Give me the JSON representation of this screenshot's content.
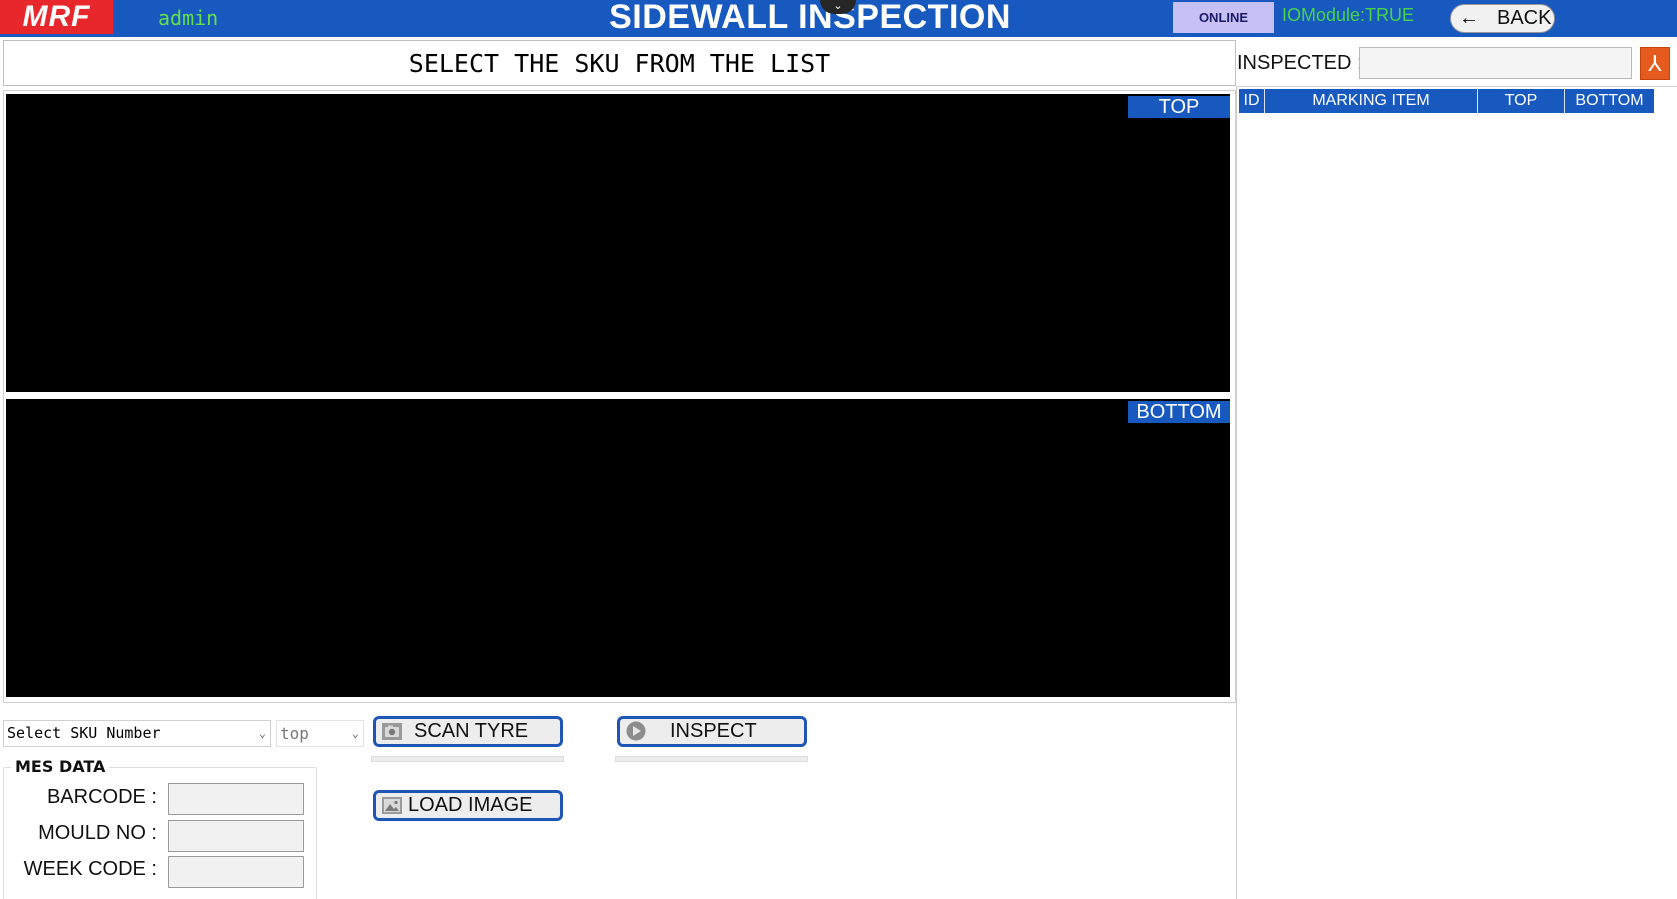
{
  "header": {
    "logo_text": "MRF",
    "user": "admin",
    "title": "SIDEWALL INSPECTION",
    "collapse_glyph": "⌄",
    "status": "ONLINE",
    "io_module": "IOModule:TRUE",
    "back_arrow": "←",
    "back_label": "BACK"
  },
  "instruction": "SELECT THE SKU FROM THE LIST",
  "views": {
    "top_label": "TOP",
    "bottom_label": "BOTTOM"
  },
  "controls": {
    "sku_select_value": "Select SKU Number",
    "side_select_value": "top",
    "scan_label": "SCAN TYRE",
    "inspect_label": "INSPECT",
    "load_label": "LOAD IMAGE"
  },
  "mes": {
    "title": "MES DATA",
    "barcode_label": "BARCODE :",
    "mould_label": "MOULD NO :",
    "week_label": "WEEK CODE :"
  },
  "right_panel": {
    "inspected_label": "INSPECTED :",
    "inspected_value": "",
    "pdf_glyph": "⅄",
    "columns": [
      "ID",
      "MARKING ITEM",
      "TOP",
      "BOTTOM"
    ]
  },
  "icons": {
    "camera": "camera-icon",
    "play": "play-icon",
    "image": "image-icon",
    "pdf": "pdf-icon"
  },
  "colors": {
    "header_bg": "#1759bf",
    "logo_red": "#e8272d",
    "user_green": "#63e04c",
    "io_green": "#47d34a",
    "online_bg": "#c6c0f5",
    "button_border": "#1f56b6",
    "pdf_orange": "#e55a1f"
  }
}
